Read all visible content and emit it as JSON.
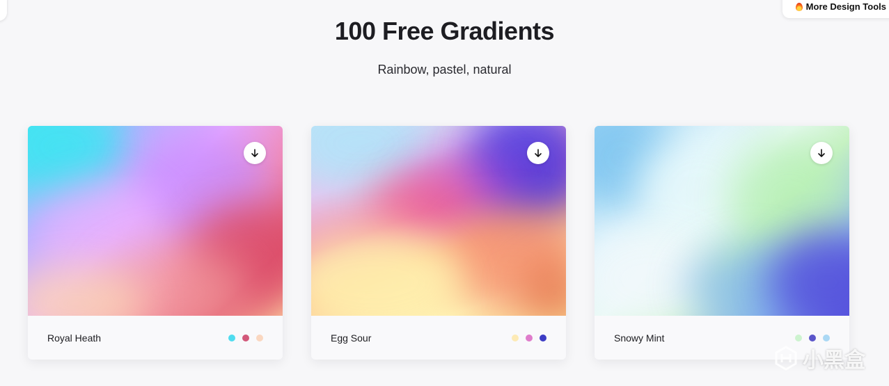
{
  "header": {
    "title": "100 Free Gradients",
    "subtitle": "Rainbow, pastel, natural",
    "more_tools_label": "More Design Tools",
    "more_tools_icon": "fire-icon"
  },
  "cards": [
    {
      "name": "Royal Heath",
      "download_icon": "arrow-down-icon",
      "colors": [
        "#4fdcef",
        "#d2587a",
        "#fad7c0"
      ]
    },
    {
      "name": "Egg Sour",
      "download_icon": "arrow-down-icon",
      "colors": [
        "#fdeab5",
        "#df7ccb",
        "#3c3cc4"
      ]
    },
    {
      "name": "Snowy Mint",
      "download_icon": "arrow-down-icon",
      "colors": [
        "#cdf3cf",
        "#5a55c9",
        "#aad8f4"
      ]
    }
  ],
  "watermark": {
    "text": "小黑盒"
  }
}
